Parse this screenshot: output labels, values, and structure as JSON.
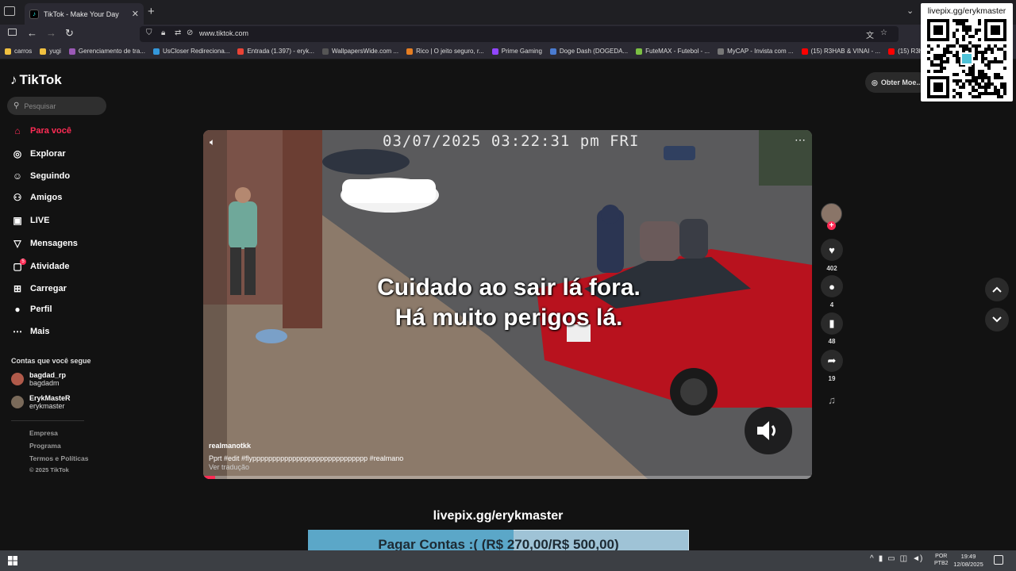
{
  "browser": {
    "tab_title": "TikTok - Make Your Day",
    "url": "www.tiktok.com",
    "bookmarks": [
      "carros",
      "yugi",
      "Gerenciamento de tra...",
      "UsCloser Redireciona...",
      "Entrada (1.397) - eryk...",
      "WallpapersWide.com ...",
      "Rico | O jeito seguro, r...",
      "Prime Gaming",
      "Doge Dash (DOGEDA...",
      "FuteMAX - Futebol - ...",
      "MyCAP - Invista com ...",
      "(15) R3HAB & VINAI - ...",
      "(15) R3h"
    ]
  },
  "sidebar": {
    "logo": "TikTok",
    "search_placeholder": "Pesquisar",
    "nav": [
      {
        "label": "Para você",
        "icon": "home-icon",
        "active": true
      },
      {
        "label": "Explorar",
        "icon": "compass-icon"
      },
      {
        "label": "Seguindo",
        "icon": "following-icon"
      },
      {
        "label": "Amigos",
        "icon": "friends-icon"
      },
      {
        "label": "LIVE",
        "icon": "live-icon"
      },
      {
        "label": "Mensagens",
        "icon": "send-icon"
      },
      {
        "label": "Atividade",
        "icon": "inbox-icon",
        "badge": "5"
      },
      {
        "label": "Carregar",
        "icon": "upload-icon"
      },
      {
        "label": "Perfil",
        "icon": "profile-icon"
      },
      {
        "label": "Mais",
        "icon": "more-icon"
      }
    ],
    "following_title": "Contas que você segue",
    "following": [
      {
        "name": "bagdad_rp",
        "username": "bagdadm"
      },
      {
        "name": "ErykMasteR",
        "username": "erykmaster"
      }
    ],
    "footer": [
      "Empresa",
      "Programa",
      "Termos e Políticas",
      "© 2025 TikTok"
    ]
  },
  "video": {
    "timestamp": "03/07/2025 03:22:31 pm FRI",
    "caption_line1": "Cuidado ao sair lá fora.",
    "caption_line2": "Há muito perigos lá.",
    "author": "realmanotkk",
    "description": "Pprt #edit  #flyppppppppppppppppppppppppppppp  #realmano",
    "translate": "Ver tradução",
    "progress": 0.02
  },
  "actions": {
    "likes": "402",
    "comments": "4",
    "saves": "48",
    "shares": "19"
  },
  "top_right": {
    "get_coins": "Obter Moe..."
  },
  "overlay": {
    "qr_label": "livepix.gg/erykmaster",
    "livepix": "livepix.gg/erykmaster",
    "goal_text": "Pagar Contas :( (R$ 270,00/R$ 500,00)",
    "goal_progress": 0.54
  },
  "taskbar": {
    "lang1": "POR",
    "lang2": "PTB2",
    "time": "19:49",
    "date": "12/08/2025"
  },
  "colors": {
    "accent": "#fe2c55",
    "background": "#121212"
  }
}
